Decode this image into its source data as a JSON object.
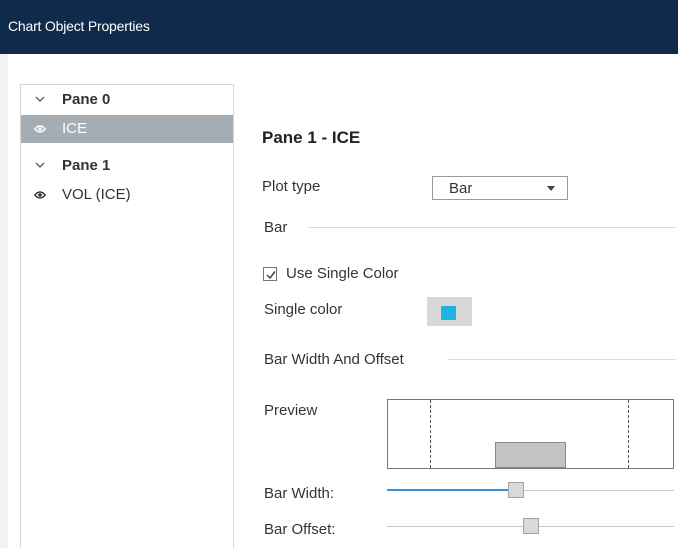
{
  "window": {
    "title": "Chart Object Properties"
  },
  "tree": {
    "items": [
      {
        "label": "Pane 0",
        "kind": "pane",
        "icon": "chevron-down-icon"
      },
      {
        "label": "ICE",
        "kind": "series",
        "icon": "eye-icon",
        "selected": true
      },
      {
        "label": "Pane 1",
        "kind": "pane",
        "icon": "chevron-down-icon"
      },
      {
        "label": "VOL (ICE)",
        "kind": "series",
        "icon": "eye-icon"
      }
    ]
  },
  "panel": {
    "title": "Pane 1 - ICE",
    "plot_type_label": "Plot type",
    "plot_type_value": "Bar",
    "bar_section": "Bar",
    "use_single_color_label": "Use Single Color",
    "use_single_color_checked": true,
    "single_color_label": "Single color",
    "single_color_value": "#1cb4e3",
    "bar_width_offset_section": "Bar Width And Offset",
    "preview_label": "Preview",
    "bar_width_label": "Bar Width:",
    "bar_width_level": 0.45,
    "bar_offset_label": "Bar Offset:",
    "bar_offset_level": 0.5
  },
  "colors": {
    "titlebar": "#0f2a4a",
    "selection": "#a5adb4",
    "slider_fill": "#3b8fd9"
  }
}
